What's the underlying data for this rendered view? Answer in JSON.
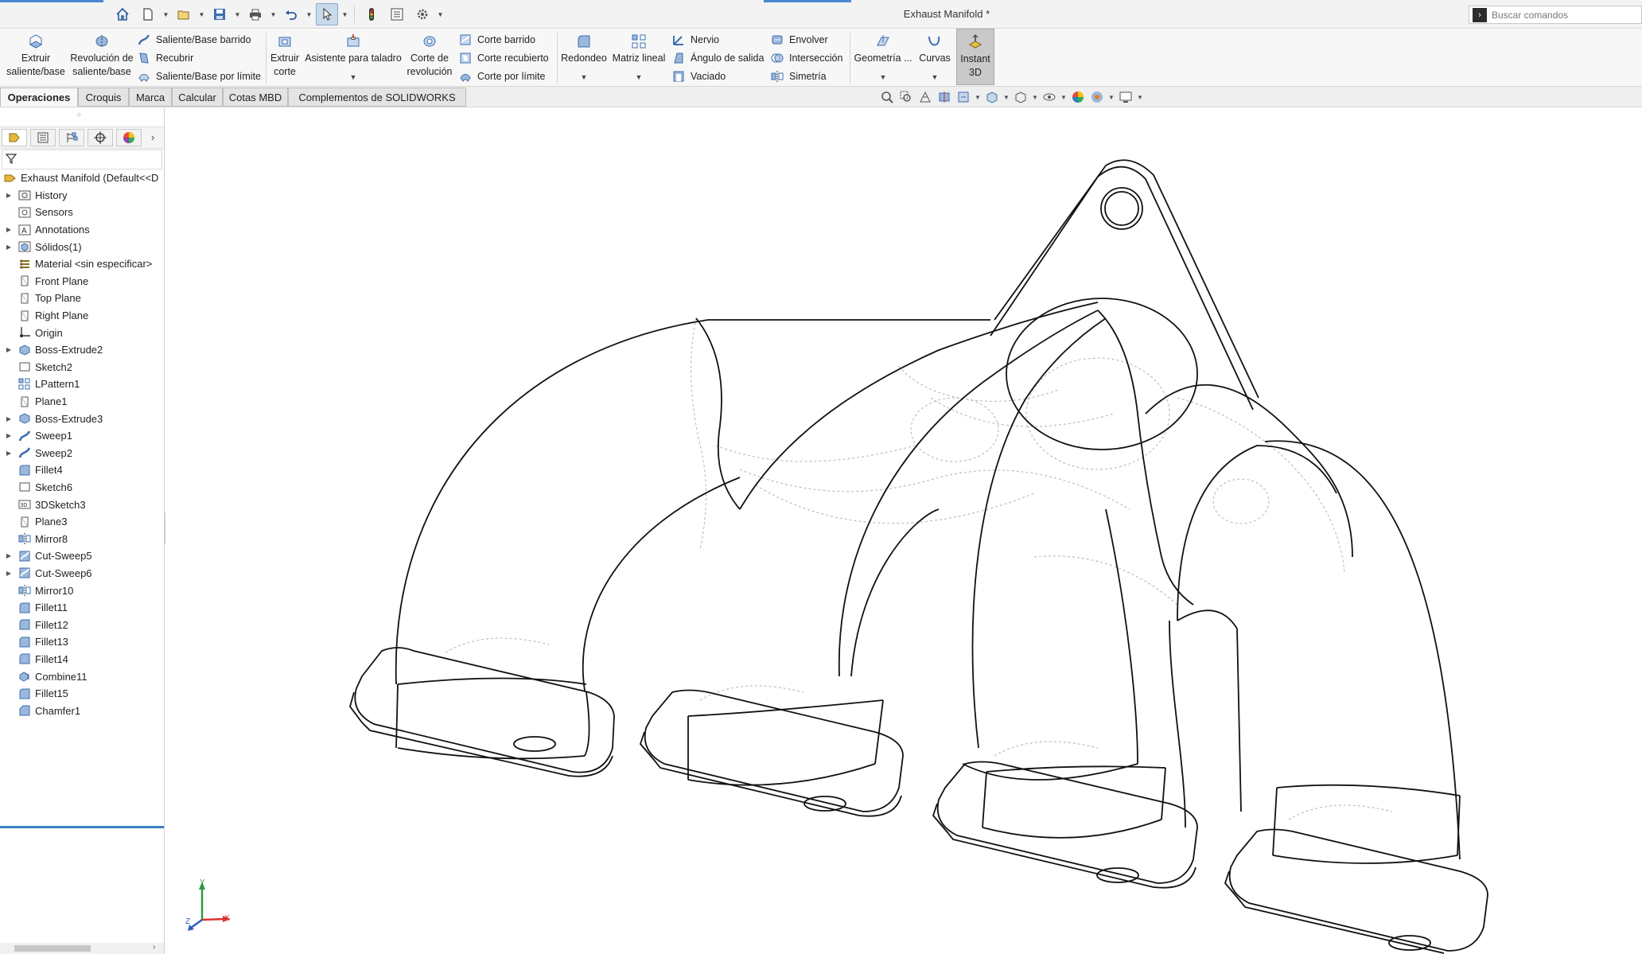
{
  "window": {
    "title": "Exhaust Manifold *"
  },
  "search": {
    "placeholder": "Buscar comandos"
  },
  "quick_access": {
    "items": [
      "home-icon",
      "new-file-icon",
      "open-file-icon",
      "save-icon",
      "print-icon",
      "undo-icon",
      "select-arrow-icon",
      "traffic-light-icon",
      "file-properties-icon",
      "gear-icon"
    ]
  },
  "ribbon": {
    "extrude_boss": "Extruir\nsaliente/base",
    "revolve_boss": "Revolución de\nsaliente/base",
    "swept_boss": "Saliente/Base barrido",
    "loft_boss": "Recubrir",
    "boundary_boss": "Saliente/Base por límite",
    "extrude_cut": "Extruir\ncorte",
    "hole_wizard": "Asistente para taladro",
    "revolve_cut": "Corte de\nrevolución",
    "swept_cut": "Corte barrido",
    "loft_cut": "Corte recubierto",
    "boundary_cut": "Corte por límite",
    "fillet": "Redondeo",
    "linear_pattern": "Matriz lineal",
    "rib": "Nervio",
    "draft": "Ángulo de salida",
    "shell": "Vaciado",
    "wrap": "Envolver",
    "intersect": "Intersección",
    "mirror": "Simetría",
    "ref_geometry": "Geometría ...",
    "curves": "Curvas",
    "instant3d": "Instant\n3D"
  },
  "tabs": [
    {
      "label": "Operaciones",
      "active": true
    },
    {
      "label": "Croquis"
    },
    {
      "label": "Marca"
    },
    {
      "label": "Calcular"
    },
    {
      "label": "Cotas MBD"
    },
    {
      "label": "Complementos de SOLIDWORKS"
    }
  ],
  "feature_tree": {
    "root": "Exhaust Manifold  (Default<<D",
    "items": [
      {
        "label": "History",
        "icon": "history-folder-icon",
        "expandable": true
      },
      {
        "label": "Sensors",
        "icon": "sensors-icon",
        "expandable": false
      },
      {
        "label": "Annotations",
        "icon": "annotations-icon",
        "expandable": true
      },
      {
        "label": "Sólidos(1)",
        "icon": "solid-bodies-icon",
        "expandable": true
      },
      {
        "label": "Material <sin especificar>",
        "icon": "material-icon",
        "expandable": false
      },
      {
        "label": "Front Plane",
        "icon": "plane-icon",
        "expandable": false
      },
      {
        "label": "Top Plane",
        "icon": "plane-icon",
        "expandable": false
      },
      {
        "label": "Right Plane",
        "icon": "plane-icon",
        "expandable": false
      },
      {
        "label": "Origin",
        "icon": "origin-icon",
        "expandable": false
      },
      {
        "label": "Boss-Extrude2",
        "icon": "extrude-icon",
        "expandable": true
      },
      {
        "label": "Sketch2",
        "icon": "sketch-icon",
        "expandable": false
      },
      {
        "label": "LPattern1",
        "icon": "linear-pattern-icon",
        "expandable": false
      },
      {
        "label": "Plane1",
        "icon": "plane-icon",
        "expandable": false
      },
      {
        "label": "Boss-Extrude3",
        "icon": "extrude-icon",
        "expandable": true
      },
      {
        "label": "Sweep1",
        "icon": "sweep-icon",
        "expandable": true
      },
      {
        "label": "Sweep2",
        "icon": "sweep-icon",
        "expandable": true
      },
      {
        "label": "Fillet4",
        "icon": "fillet-icon",
        "expandable": false
      },
      {
        "label": "Sketch6",
        "icon": "sketch-icon",
        "expandable": false
      },
      {
        "label": "3DSketch3",
        "icon": "3d-sketch-icon",
        "expandable": false
      },
      {
        "label": "Plane3",
        "icon": "plane-icon",
        "expandable": false
      },
      {
        "label": "Mirror8",
        "icon": "mirror-icon",
        "expandable": false
      },
      {
        "label": "Cut-Sweep5",
        "icon": "cut-sweep-icon",
        "expandable": true
      },
      {
        "label": "Cut-Sweep6",
        "icon": "cut-sweep-icon",
        "expandable": true
      },
      {
        "label": "Mirror10",
        "icon": "mirror-icon",
        "expandable": false
      },
      {
        "label": "Fillet11",
        "icon": "fillet-icon",
        "expandable": false
      },
      {
        "label": "Fillet12",
        "icon": "fillet-icon",
        "expandable": false
      },
      {
        "label": "Fillet13",
        "icon": "fillet-icon",
        "expandable": false
      },
      {
        "label": "Fillet14",
        "icon": "fillet-icon",
        "expandable": false
      },
      {
        "label": "Combine11",
        "icon": "combine-icon",
        "expandable": false
      },
      {
        "label": "Fillet15",
        "icon": "fillet-icon",
        "expandable": false
      },
      {
        "label": "Chamfer1",
        "icon": "chamfer-icon",
        "expandable": false
      }
    ]
  },
  "triad": {
    "x": "X",
    "y": "Y",
    "z": "Z"
  },
  "colors": {
    "accent": "#3e7fc6",
    "ribbon_bg": "#f7f7f7",
    "instant3d_active": "#c9c9c9"
  }
}
